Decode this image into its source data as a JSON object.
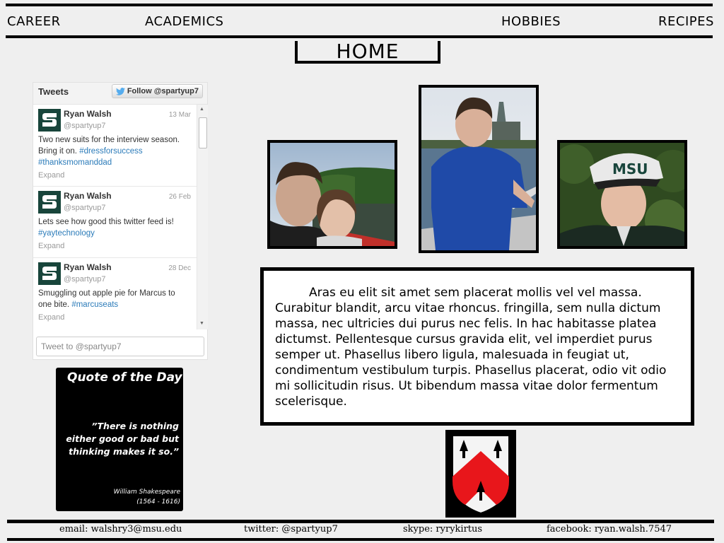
{
  "nav": {
    "career": "CAREER",
    "academics": "ACADEMICS",
    "hobbies": "HOBBIES",
    "recipes": "RECIPES"
  },
  "page_title": "HOME",
  "twitter": {
    "header": "Tweets",
    "follow_label": "Follow @spartyup7",
    "tweets": [
      {
        "name": "Ryan Walsh",
        "handle": "@spartyup7",
        "date": "13 Mar",
        "text": "Two new suits for the interview season. Bring it on.",
        "tags": "#dressforsuccess #thanksmomanddad",
        "expand": "Expand"
      },
      {
        "name": "Ryan Walsh",
        "handle": "@spartyup7",
        "date": "26 Feb",
        "text": "Lets see how good this twitter feed is!",
        "tags": "#yaytechnology",
        "expand": "Expand"
      },
      {
        "name": "Ryan Walsh",
        "handle": "@spartyup7",
        "date": "28 Dec",
        "text": "Smuggling out apple pie for Marcus to one bite.",
        "tags": "#marcuseats",
        "expand": "Expand"
      }
    ],
    "compose_placeholder": "Tweet to @spartyup7"
  },
  "quote": {
    "title": "Quote of the Day",
    "text": "”There is nothing either good or bad but thinking makes it so.”",
    "author": "William Shakespeare",
    "years": "(1564 - 1616)"
  },
  "body_text": "Aras eu elit sit amet sem placerat mollis vel vel massa. Curabitur blandit, arcu vitae rhoncus. fringilla, sem nulla dictum massa, nec ultricies dui purus nec felis. In hac habitasse platea dictumst. Pellentesque cursus gravida elit, vel imperdiet purus semper ut. Phasellus libero ligula, malesuada in feugiat ut, condimentum vestibulum turpis. Phasellus placerat, odio vit odio mi sollicitudin risus. Ut bibendum massa vitae dolor fermentum scelerisque.",
  "footer": {
    "email": "email: walshry3@msu.edu",
    "twitter": "twitter: @spartyup7",
    "skype": "skype: ryrykirtus",
    "facebook": "facebook: ryan.walsh.7547"
  },
  "colors": {
    "spartan_green": "#18453b",
    "twitter_blue": "#2b7bb9",
    "crest_red": "#e8161b"
  }
}
